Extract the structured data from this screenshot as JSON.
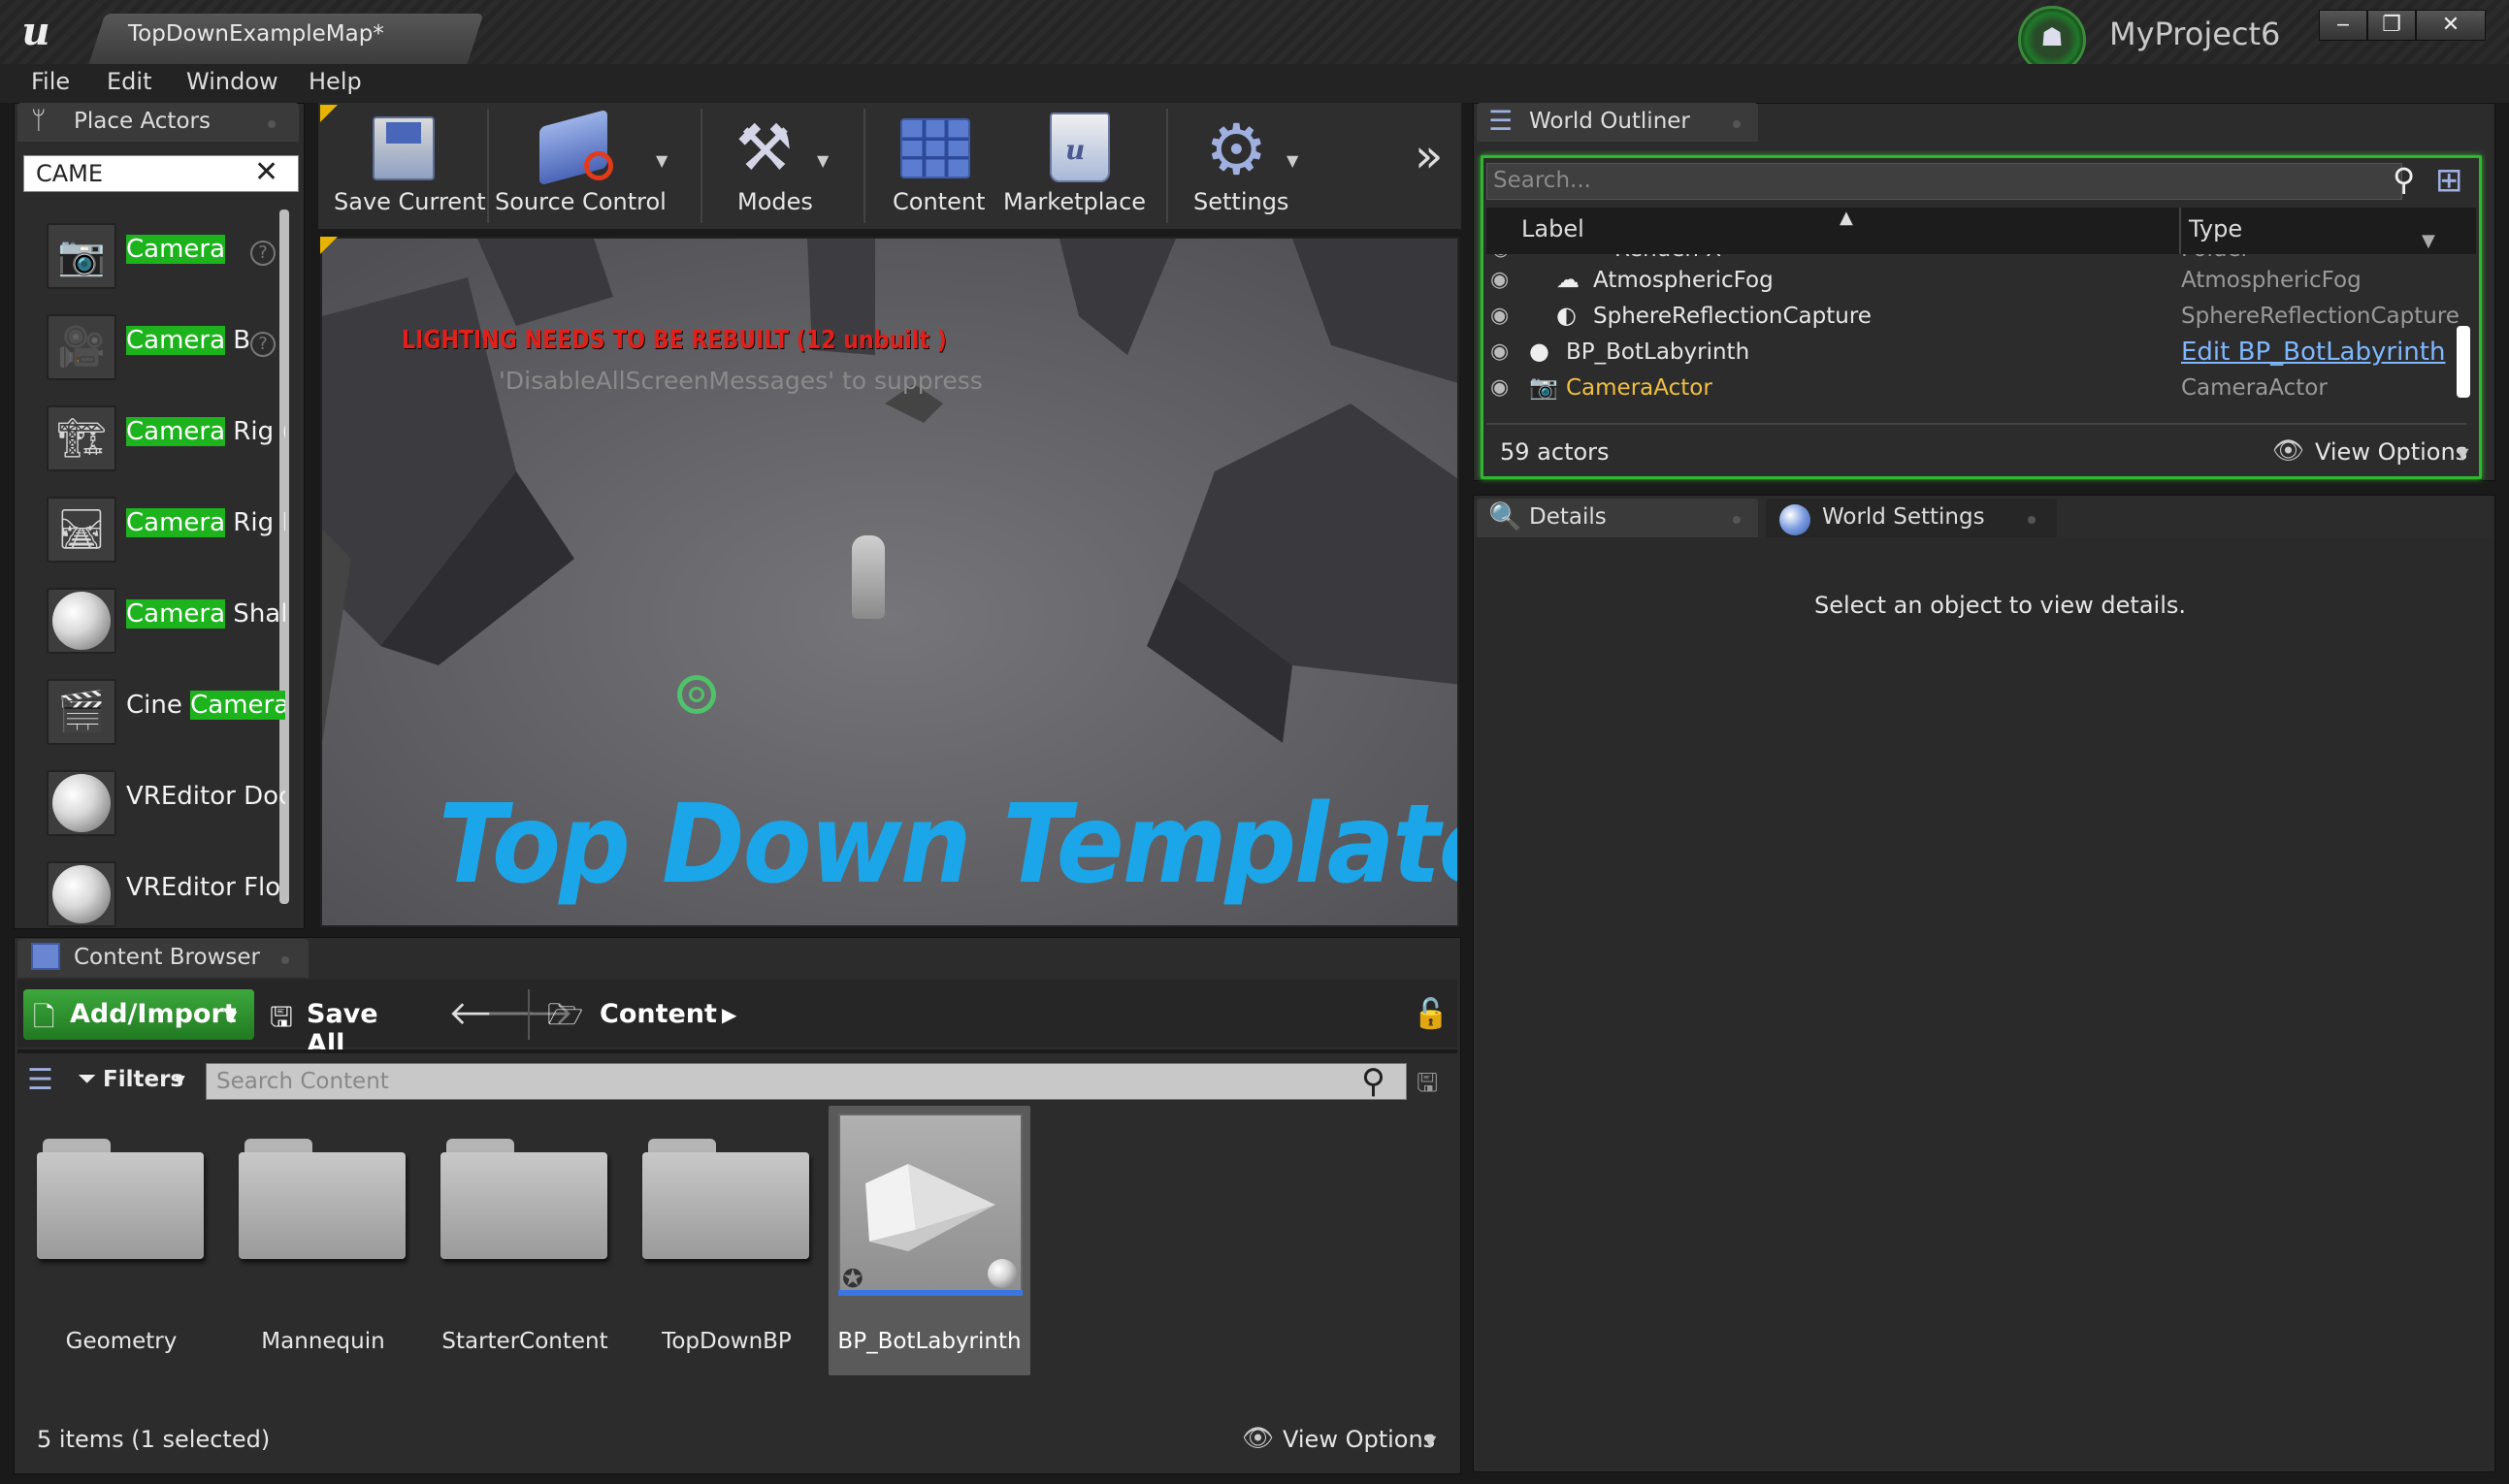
{
  "titlebar": {
    "map_tab": "TopDownExampleMap*",
    "project_name": "MyProject6",
    "buttons": [
      "minimize",
      "restore",
      "close"
    ]
  },
  "menu": [
    "File",
    "Edit",
    "Window",
    "Help"
  ],
  "place_actors": {
    "tab_label": "Place Actors",
    "search_value": "CAME",
    "items": [
      {
        "before": "",
        "match": "Camera",
        "after": "",
        "icon": "camera-icon",
        "help": true
      },
      {
        "before": "",
        "match": "Camera",
        "after": " B",
        "icon": "camera-hand-icon",
        "help": true
      },
      {
        "before": "",
        "match": "Camera",
        "after": " Rig (",
        "icon": "camera-rig-crane-icon",
        "help": false
      },
      {
        "before": "",
        "match": "Camera",
        "after": " Rig R",
        "icon": "camera-rig-rail-icon",
        "help": false
      },
      {
        "before": "",
        "match": "Camera",
        "after": " Shal",
        "icon": "sphere-icon",
        "help": false
      },
      {
        "before": "Cine ",
        "match": "Camera",
        "after": "",
        "icon": "cine-camera-icon",
        "help": false
      },
      {
        "before": "VREditor Doc",
        "match": "",
        "after": "",
        "icon": "sphere-icon",
        "help": false
      },
      {
        "before": "VREditor Flo",
        "match": "",
        "after": "",
        "icon": "sphere-icon",
        "help": false
      }
    ]
  },
  "toolbar": {
    "save_current": "Save Current",
    "source_control": "Source Control",
    "modes": "Modes",
    "content": "Content",
    "marketplace": "Marketplace",
    "settings": "Settings"
  },
  "viewport": {
    "warning": "LIGHTING NEEDS TO BE REBUILT (12 unbuilt )",
    "hint": "'DisableAllScreenMessages' to suppress",
    "banner": "Top Down Template"
  },
  "outliner": {
    "tab_label": "World Outliner",
    "search_placeholder": "Search...",
    "col_label": "Label",
    "col_type": "Type",
    "partial_row": {
      "label": "Renden X",
      "type": "Folder"
    },
    "rows": [
      {
        "label": "AtmosphericFog",
        "type": "AtmosphericFog",
        "icon": "fog-icon",
        "type_link": false,
        "selected_color": false
      },
      {
        "label": "SphereReflectionCapture",
        "type": "SphereReflectionCapture",
        "icon": "reflection-capture-icon",
        "type_link": false,
        "selected_color": false
      },
      {
        "label": "BP_BotLabyrinth",
        "type": "Edit BP_BotLabyrinth",
        "icon": "blueprint-sphere-icon",
        "type_link": true,
        "selected_color": false
      },
      {
        "label": "CameraActor",
        "type": "CameraActor",
        "icon": "camera-actor-icon",
        "type_link": false,
        "selected_color": true
      }
    ],
    "actor_count": "59 actors",
    "view_options": "View Options"
  },
  "details": {
    "tab_details": "Details",
    "tab_world_settings": "World Settings",
    "empty_message": "Select an object to view details."
  },
  "content_browser": {
    "tab_label": "Content Browser",
    "add_import": "Add/Import",
    "save_all": "Save All",
    "path": "Content",
    "filters": "Filters",
    "search_placeholder": "Search Content",
    "folders": [
      "Geometry",
      "Mannequin",
      "StarterContent",
      "TopDownBP"
    ],
    "asset": "BP_BotLabyrinth",
    "status": "5 items (1 selected)",
    "view_options": "View Options"
  },
  "colors": {
    "accent_green": "#1db31d",
    "warning_red": "#e0201a",
    "banner_blue": "#1aa6e8",
    "link_blue": "#7fb7ff",
    "selected_orange": "#f0c040"
  }
}
